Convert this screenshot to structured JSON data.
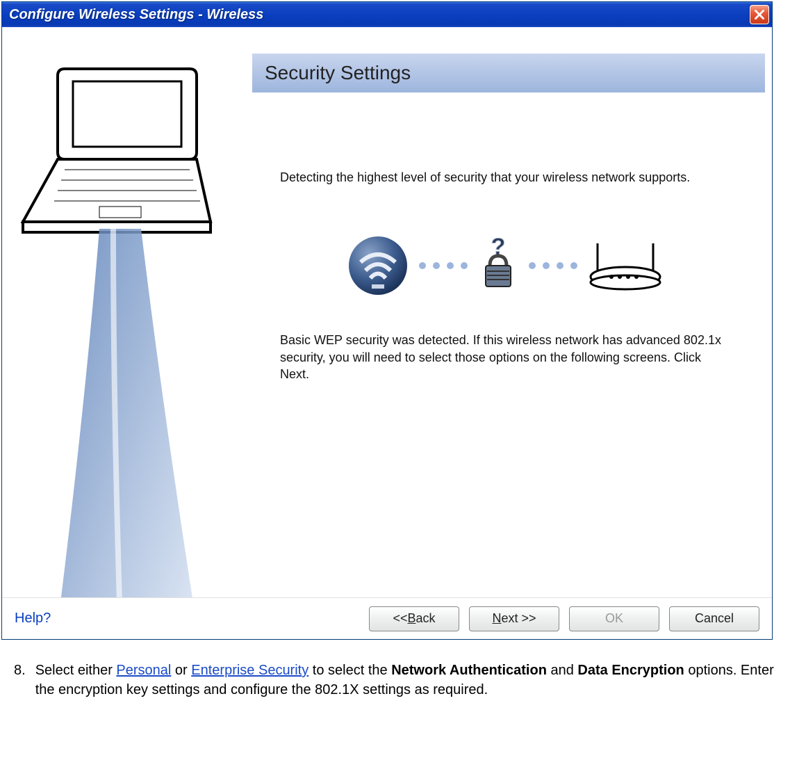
{
  "window": {
    "title": "Configure Wireless Settings  -  Wireless"
  },
  "header": {
    "title": "Security Settings"
  },
  "content": {
    "detecting": "Detecting the highest level of security that your wireless network supports.",
    "result": "Basic WEP security was detected. If this wireless network has advanced 802.1x security, you will need to select those options on the following screens. Click Next."
  },
  "footer": {
    "help": "Help?",
    "back": "<< Back",
    "next": "Next >>",
    "ok": "OK",
    "cancel": "Cancel"
  },
  "instruction": {
    "number": "8.",
    "pre": "Select either ",
    "link1": "Personal",
    "mid1": " or ",
    "link2": "Enterprise Security",
    "mid2": " to select the ",
    "bold1": "Network Authentication",
    "mid3": " and ",
    "bold2": "Data Encryption",
    "post": " options. Enter the encryption key settings and configure the 802.1X settings as required."
  }
}
